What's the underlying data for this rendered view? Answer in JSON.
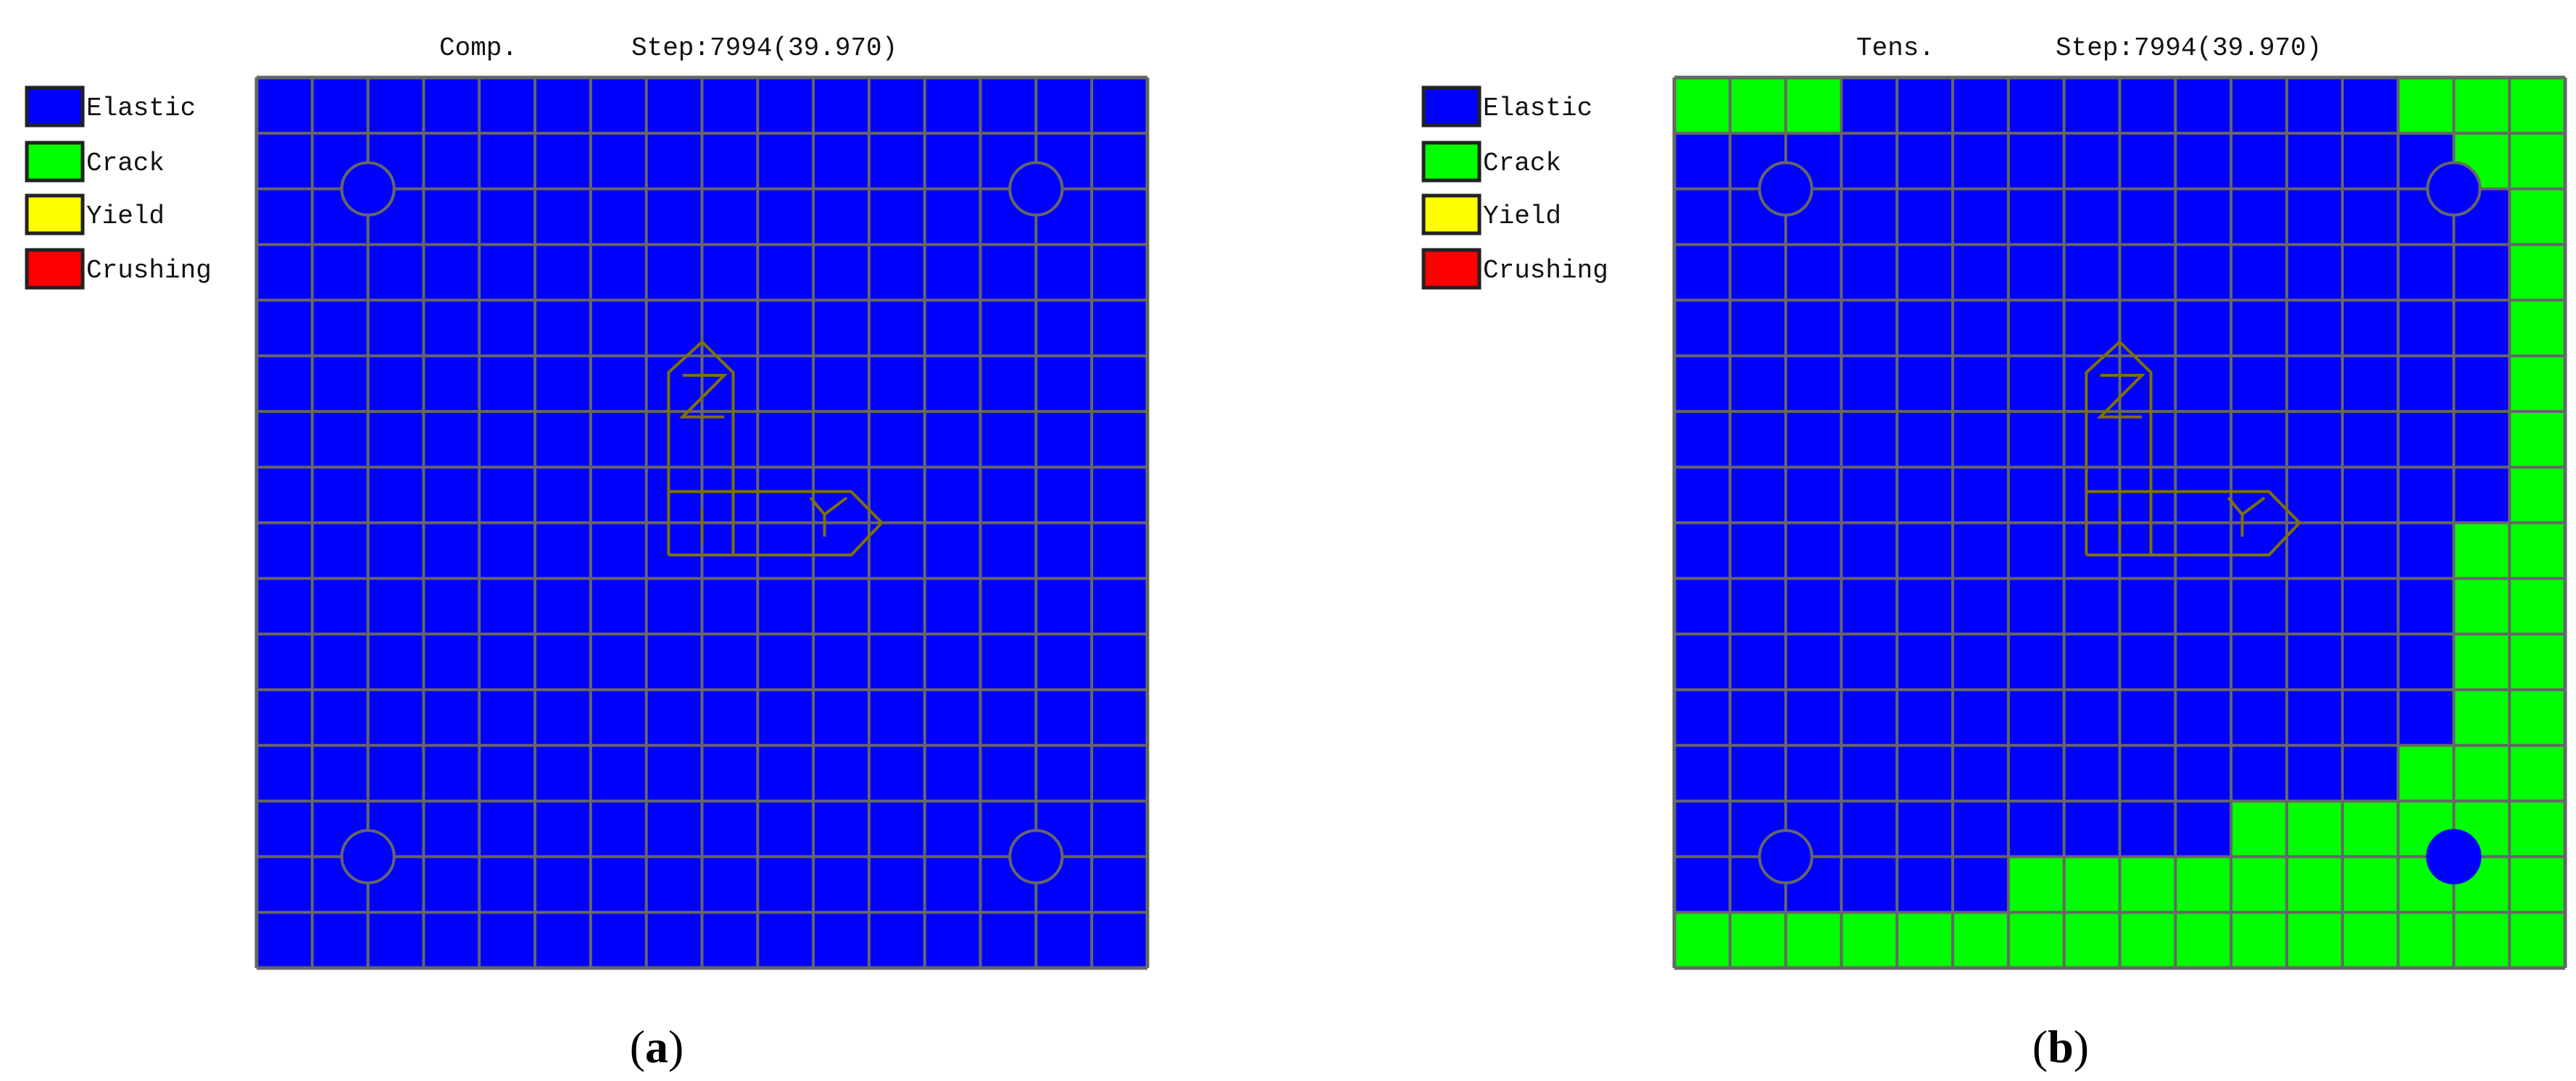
{
  "colors": {
    "Elastic": "#0000ff",
    "Crack": "#00ff00",
    "Yield": "#ffff00",
    "Crushing": "#ff0000",
    "grid": "#666666",
    "axis": "#807000"
  },
  "legend": [
    {
      "key": "E",
      "label": "Elastic",
      "color": "#0000ff"
    },
    {
      "key": "C",
      "label": "Crack",
      "color": "#00ff00"
    },
    {
      "key": "Y",
      "label": "Yield",
      "color": "#ffff00"
    },
    {
      "key": "R",
      "label": "Crushing",
      "color": "#ff0000"
    }
  ],
  "axis_labels": {
    "vertical": "Z",
    "horizontal": "Y"
  },
  "panels": [
    {
      "id": "a",
      "mode": "Comp.",
      "step": "Step:7994(39.970)",
      "caption_letter": "a",
      "cells": [
        "EEEEEEEEEEEEEEEE",
        "EEEEEEEEEEEEEEEE",
        "EEEEEEEEEEEEEEEE",
        "EEEEEEEEEEEEEEEE",
        "EEEEEEEEEEEEEEEE",
        "EEEEEEEEEEEEEEEE",
        "EEEEEEEEEEEEEEEE",
        "EEEEEEEEEEEEEEEE",
        "EEEEEEEEEEEEEEEE",
        "EEEEEEEEEEEEEEEE",
        "EEEEEEEEEEEEEEEE",
        "EEEEEEEEEEEEEEEE",
        "EEEEEEEEEEEEEEEE",
        "EEEEEEEEEEEEEEEE",
        "EEEEEEEEEEEEEEEE",
        "EEEEEEEEEEEEEEEE"
      ],
      "holes": [
        {
          "filled": false
        },
        {
          "filled": false
        },
        {
          "filled": false
        },
        {
          "filled": false
        }
      ]
    },
    {
      "id": "b",
      "mode": "Tens.",
      "step": "Step:7994(39.970)",
      "caption_letter": "b",
      "cells": [
        "CCCEEEEEEEEEECCC",
        "EEEEEEEEEEEEEECC",
        "EEEEEEEEEEEEEEEC",
        "EEEEEEEEEEEEEEEC",
        "EEEEEEEEEEEEEEEC",
        "EEEEEEEEEEEEEEEC",
        "EEEEEEEEEEEEEEEC",
        "EEEEEEEEEEEEEEEC",
        "EEEEEEEEEEEEEECC",
        "EEEEEEEEEEEEEECC",
        "EEEEEEEEEEEEEECC",
        "EEEEEEEEEEEEEECC",
        "EEEEEEEEEEEEECCC",
        "EEEEEEEEEECCCCCC",
        "EEEEEECCCCCCCCCC",
        "CCCCCCCCCCCCCCCC"
      ],
      "holes": [
        {
          "filled": false
        },
        {
          "filled": false
        },
        {
          "filled": false
        },
        {
          "filled": true
        }
      ]
    }
  ]
}
